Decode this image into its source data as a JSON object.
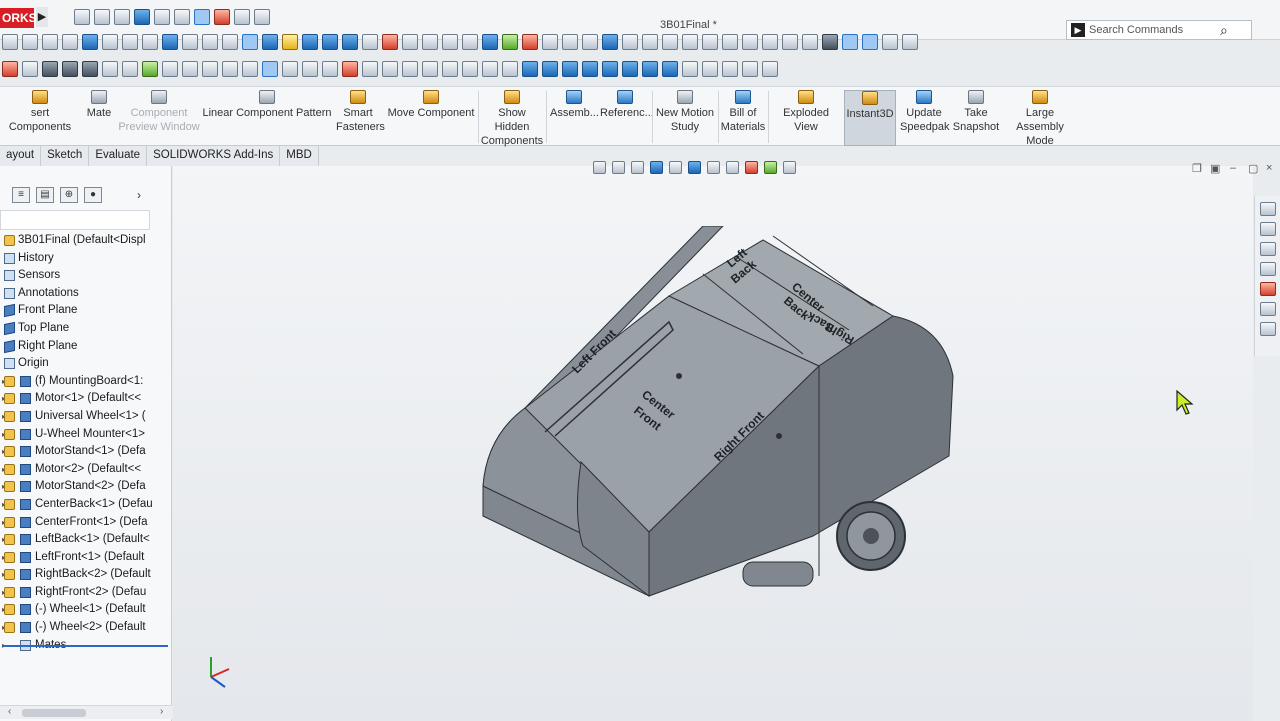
{
  "app": {
    "logo_text": "ORKS",
    "document_title": "3B01Final *"
  },
  "search": {
    "placeholder": "Search Commands"
  },
  "ribbon": {
    "insert_components": "sert Components",
    "mate": "Mate",
    "component_preview_line1": "Component",
    "component_preview_line2": "Preview Window",
    "linear_pattern": "Linear Component Pattern",
    "smart_fasteners_line1": "Smart",
    "smart_fasteners_line2": "Fasteners",
    "move_component": "Move Component",
    "show_hidden_line1": "Show Hidden",
    "show_hidden_line2": "Components",
    "assembly": "Assemb...",
    "reference": "Referenc...",
    "new_motion_line1": "New Motion",
    "new_motion_line2": "Study",
    "bom_line1": "Bill of",
    "bom_line2": "Materials",
    "exploded_view": "Exploded View",
    "instant3d": "Instant3D",
    "update_speedpak_line1": "Update",
    "update_speedpak_line2": "Speedpak",
    "take_snapshot_line1": "Take",
    "take_snapshot_line2": "Snapshot",
    "large_assembly_line1": "Large Assembly",
    "large_assembly_line2": "Mode"
  },
  "tabs": [
    "ayout",
    "Sketch",
    "Evaluate",
    "SOLIDWORKS Add-Ins",
    "MBD"
  ],
  "tree": {
    "root": "3B01Final (Default<Displ",
    "items": [
      "History",
      "Sensors",
      "Annotations",
      "Front Plane",
      "Top Plane",
      "Right Plane",
      "Origin",
      "(f) MountingBoard<1:",
      "Motor<1> (Default<<",
      "Universal Wheel<1> (",
      "U-Wheel Mounter<1>",
      "MotorStand<1> (Defa",
      "Motor<2> (Default<<",
      "MotorStand<2> (Defa",
      "CenterBack<1> (Defau",
      "CenterFront<1> (Defa",
      "LeftBack<1> (Default<",
      "LeftFront<1> (Default",
      "RightBack<2> (Default",
      "RightFront<2> (Defau",
      "(-) Wheel<1> (Default",
      "(-) Wheel<2> (Default",
      "Mates"
    ]
  },
  "model_labels": {
    "left_back_1": "Left",
    "left_back_2": "Back",
    "center_back_1": "Center",
    "center_back_2": "Back",
    "right_back_1": "Right",
    "right_back_2": "Back",
    "left_front": "Left Front",
    "center_front_1": "Center",
    "center_front_2": "Front",
    "right_front": "Right Front"
  },
  "colors": {
    "brand_red": "#d71e26",
    "selection_blue": "#2f67c8",
    "model_gray": "#7e858c"
  }
}
